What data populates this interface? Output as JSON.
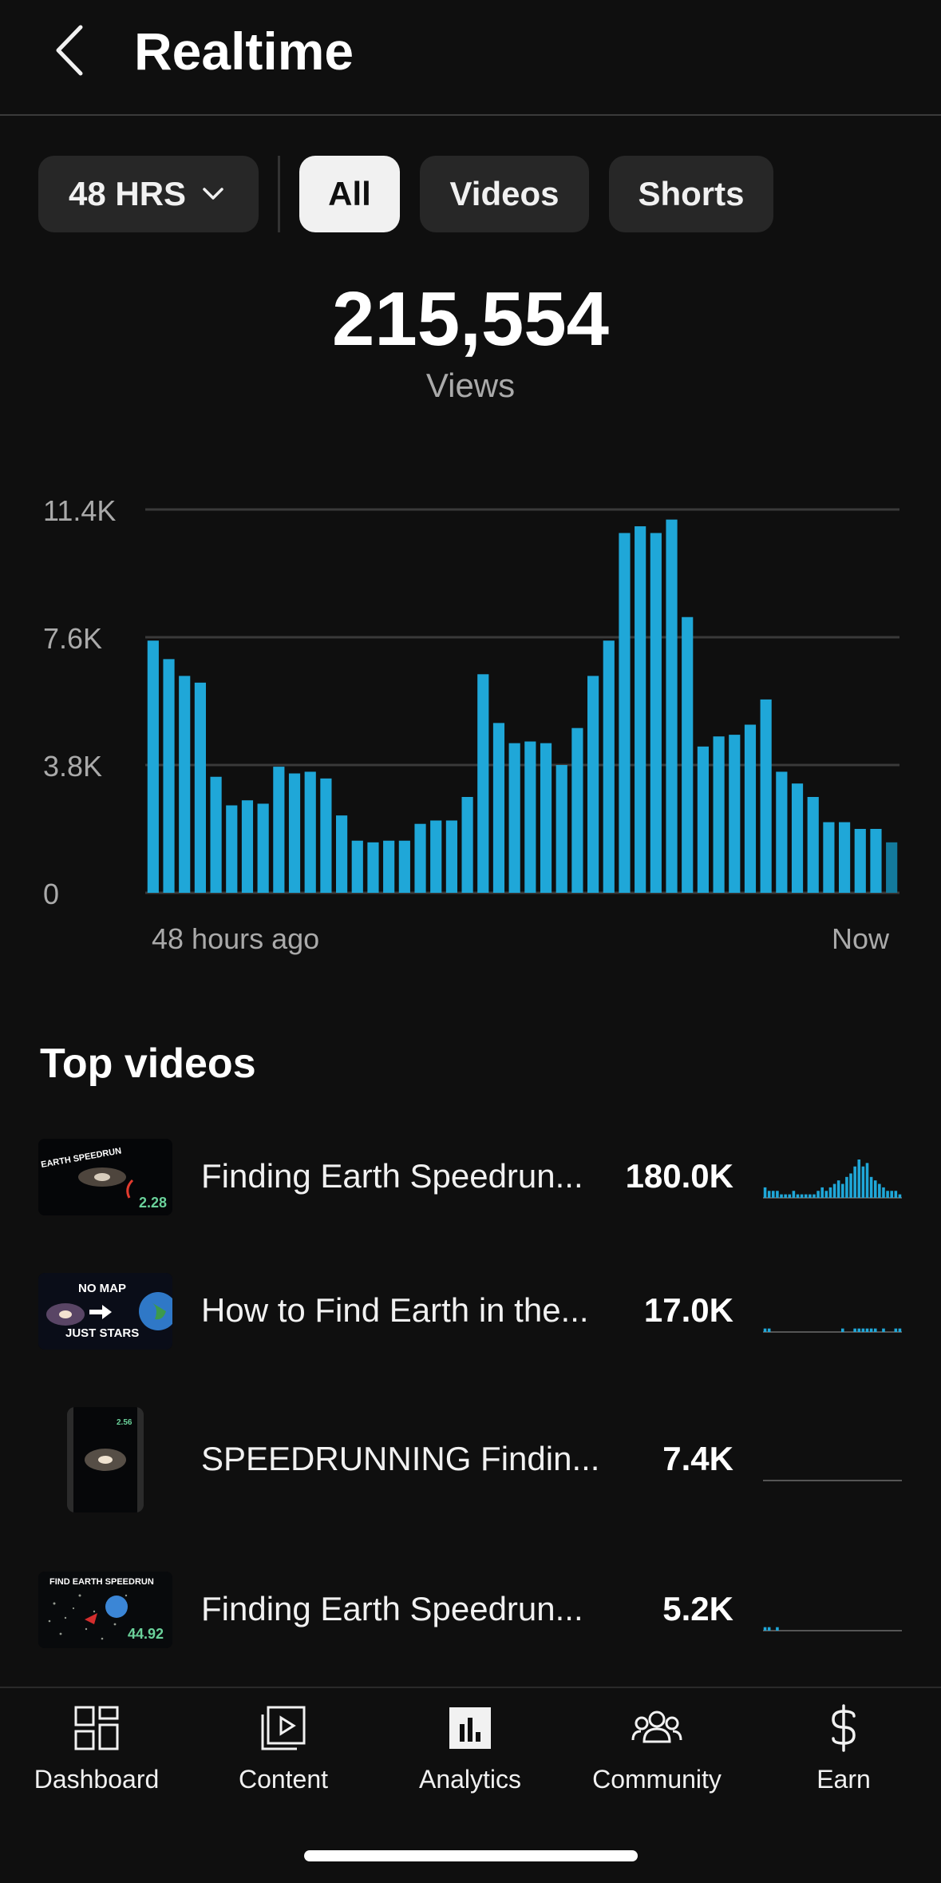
{
  "header": {
    "title": "Realtime",
    "back_icon": "chevron-left-icon"
  },
  "filters": {
    "range_label": "48 HRS",
    "tabs": [
      {
        "label": "All",
        "selected": true
      },
      {
        "label": "Videos",
        "selected": false
      },
      {
        "label": "Shorts",
        "selected": false
      }
    ]
  },
  "summary": {
    "total": "215,554",
    "label": "Views"
  },
  "chart_data": {
    "type": "bar",
    "title": "",
    "xlabel": "",
    "ylabel": "",
    "x_start_label": "48 hours ago",
    "x_end_label": "Now",
    "y_ticks": [
      "0",
      "3.8K",
      "7.6K",
      "11.4K"
    ],
    "ylim": [
      0,
      11400
    ],
    "grid": true,
    "bar_color": "#1fa7d8",
    "values": [
      7500,
      6950,
      6450,
      6250,
      3450,
      2600,
      2750,
      2650,
      3750,
      3550,
      3600,
      3400,
      2300,
      1550,
      1500,
      1550,
      1550,
      2050,
      2150,
      2150,
      2850,
      6500,
      5050,
      4450,
      4500,
      4450,
      3800,
      4900,
      6450,
      7500,
      10700,
      10900,
      10700,
      11100,
      8200,
      4350,
      4650,
      4700,
      5000,
      5750,
      3600,
      3250,
      2850,
      2100,
      2100,
      1900,
      1900,
      1500
    ]
  },
  "top_videos": {
    "title": "Top videos",
    "items": [
      {
        "title": "Finding Earth Speedrun...",
        "views": "180.0K",
        "thumb_text": "EARTH SPEEDRUN",
        "thumb_time": "2.28",
        "spark": [
          3,
          2,
          2,
          2,
          1,
          1,
          1,
          2,
          1,
          1,
          1,
          1,
          1,
          2,
          3,
          2,
          3,
          4,
          5,
          4,
          6,
          7,
          9,
          11,
          9,
          10,
          6,
          5,
          4,
          3,
          2,
          2,
          2,
          1
        ]
      },
      {
        "title": "How to Find Earth in the...",
        "views": "17.0K",
        "thumb_text_top": "NO MAP",
        "thumb_text_bottom": "JUST STARS",
        "spark": [
          1,
          1,
          0,
          0,
          0,
          0,
          0,
          0,
          0,
          0,
          0,
          0,
          0,
          0,
          0,
          0,
          0,
          0,
          0,
          1,
          0,
          0,
          1,
          1,
          1,
          1,
          1,
          1,
          0,
          1,
          0,
          0,
          1,
          1
        ]
      },
      {
        "title": "SPEEDRUNNING Findin...",
        "views": "7.4K",
        "thumb_time": "2.56",
        "spark": []
      },
      {
        "title": "Finding Earth Speedrun...",
        "views": "5.2K",
        "thumb_text": "FIND EARTH SPEEDRUN",
        "thumb_time": "44.92",
        "spark": [
          1,
          1,
          0,
          1,
          0,
          0,
          0,
          0,
          0,
          0,
          0,
          0,
          0,
          0,
          0,
          0,
          0,
          0,
          0,
          0,
          0,
          0,
          0,
          0,
          0,
          0,
          0,
          0,
          0,
          0,
          0,
          0,
          0,
          0
        ]
      }
    ]
  },
  "nav": {
    "items": [
      {
        "label": "Dashboard",
        "icon": "dashboard-icon",
        "active": false
      },
      {
        "label": "Content",
        "icon": "content-icon",
        "active": false
      },
      {
        "label": "Analytics",
        "icon": "analytics-icon",
        "active": true
      },
      {
        "label": "Community",
        "icon": "community-icon",
        "active": false
      },
      {
        "label": "Earn",
        "icon": "dollar-icon",
        "active": false
      }
    ]
  }
}
